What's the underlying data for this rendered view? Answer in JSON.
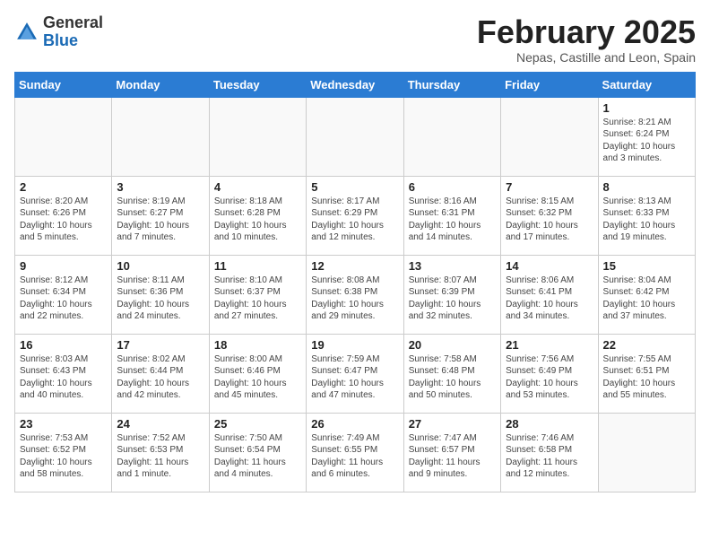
{
  "header": {
    "logo_general": "General",
    "logo_blue": "Blue",
    "month_title": "February 2025",
    "subtitle": "Nepas, Castille and Leon, Spain"
  },
  "weekdays": [
    "Sunday",
    "Monday",
    "Tuesday",
    "Wednesday",
    "Thursday",
    "Friday",
    "Saturday"
  ],
  "weeks": [
    [
      {
        "day": "",
        "info": ""
      },
      {
        "day": "",
        "info": ""
      },
      {
        "day": "",
        "info": ""
      },
      {
        "day": "",
        "info": ""
      },
      {
        "day": "",
        "info": ""
      },
      {
        "day": "",
        "info": ""
      },
      {
        "day": "1",
        "info": "Sunrise: 8:21 AM\nSunset: 6:24 PM\nDaylight: 10 hours and 3 minutes."
      }
    ],
    [
      {
        "day": "2",
        "info": "Sunrise: 8:20 AM\nSunset: 6:26 PM\nDaylight: 10 hours and 5 minutes."
      },
      {
        "day": "3",
        "info": "Sunrise: 8:19 AM\nSunset: 6:27 PM\nDaylight: 10 hours and 7 minutes."
      },
      {
        "day": "4",
        "info": "Sunrise: 8:18 AM\nSunset: 6:28 PM\nDaylight: 10 hours and 10 minutes."
      },
      {
        "day": "5",
        "info": "Sunrise: 8:17 AM\nSunset: 6:29 PM\nDaylight: 10 hours and 12 minutes."
      },
      {
        "day": "6",
        "info": "Sunrise: 8:16 AM\nSunset: 6:31 PM\nDaylight: 10 hours and 14 minutes."
      },
      {
        "day": "7",
        "info": "Sunrise: 8:15 AM\nSunset: 6:32 PM\nDaylight: 10 hours and 17 minutes."
      },
      {
        "day": "8",
        "info": "Sunrise: 8:13 AM\nSunset: 6:33 PM\nDaylight: 10 hours and 19 minutes."
      }
    ],
    [
      {
        "day": "9",
        "info": "Sunrise: 8:12 AM\nSunset: 6:34 PM\nDaylight: 10 hours and 22 minutes."
      },
      {
        "day": "10",
        "info": "Sunrise: 8:11 AM\nSunset: 6:36 PM\nDaylight: 10 hours and 24 minutes."
      },
      {
        "day": "11",
        "info": "Sunrise: 8:10 AM\nSunset: 6:37 PM\nDaylight: 10 hours and 27 minutes."
      },
      {
        "day": "12",
        "info": "Sunrise: 8:08 AM\nSunset: 6:38 PM\nDaylight: 10 hours and 29 minutes."
      },
      {
        "day": "13",
        "info": "Sunrise: 8:07 AM\nSunset: 6:39 PM\nDaylight: 10 hours and 32 minutes."
      },
      {
        "day": "14",
        "info": "Sunrise: 8:06 AM\nSunset: 6:41 PM\nDaylight: 10 hours and 34 minutes."
      },
      {
        "day": "15",
        "info": "Sunrise: 8:04 AM\nSunset: 6:42 PM\nDaylight: 10 hours and 37 minutes."
      }
    ],
    [
      {
        "day": "16",
        "info": "Sunrise: 8:03 AM\nSunset: 6:43 PM\nDaylight: 10 hours and 40 minutes."
      },
      {
        "day": "17",
        "info": "Sunrise: 8:02 AM\nSunset: 6:44 PM\nDaylight: 10 hours and 42 minutes."
      },
      {
        "day": "18",
        "info": "Sunrise: 8:00 AM\nSunset: 6:46 PM\nDaylight: 10 hours and 45 minutes."
      },
      {
        "day": "19",
        "info": "Sunrise: 7:59 AM\nSunset: 6:47 PM\nDaylight: 10 hours and 47 minutes."
      },
      {
        "day": "20",
        "info": "Sunrise: 7:58 AM\nSunset: 6:48 PM\nDaylight: 10 hours and 50 minutes."
      },
      {
        "day": "21",
        "info": "Sunrise: 7:56 AM\nSunset: 6:49 PM\nDaylight: 10 hours and 53 minutes."
      },
      {
        "day": "22",
        "info": "Sunrise: 7:55 AM\nSunset: 6:51 PM\nDaylight: 10 hours and 55 minutes."
      }
    ],
    [
      {
        "day": "23",
        "info": "Sunrise: 7:53 AM\nSunset: 6:52 PM\nDaylight: 10 hours and 58 minutes."
      },
      {
        "day": "24",
        "info": "Sunrise: 7:52 AM\nSunset: 6:53 PM\nDaylight: 11 hours and 1 minute."
      },
      {
        "day": "25",
        "info": "Sunrise: 7:50 AM\nSunset: 6:54 PM\nDaylight: 11 hours and 4 minutes."
      },
      {
        "day": "26",
        "info": "Sunrise: 7:49 AM\nSunset: 6:55 PM\nDaylight: 11 hours and 6 minutes."
      },
      {
        "day": "27",
        "info": "Sunrise: 7:47 AM\nSunset: 6:57 PM\nDaylight: 11 hours and 9 minutes."
      },
      {
        "day": "28",
        "info": "Sunrise: 7:46 AM\nSunset: 6:58 PM\nDaylight: 11 hours and 12 minutes."
      },
      {
        "day": "",
        "info": ""
      }
    ]
  ]
}
